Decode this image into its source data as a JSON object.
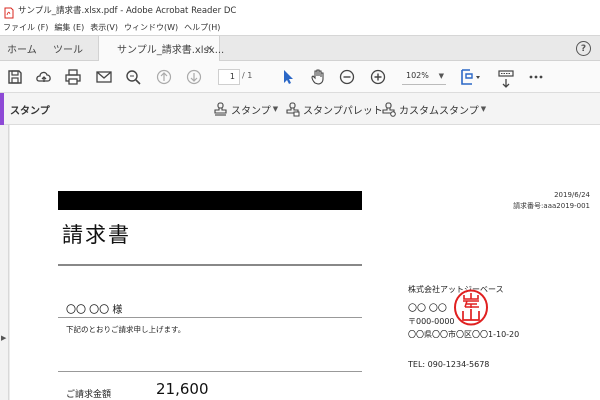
{
  "window": {
    "title": "サンプル_請求書.xlsx.pdf - Adobe Acrobat Reader DC"
  },
  "menu": [
    "ファイル (F)",
    "編集 (E)",
    "表示(V)",
    "ウィンドウ(W)",
    "ヘルプ(H)"
  ],
  "tabs": {
    "home": "ホーム",
    "tools": "ツール",
    "document": "サンプル_請求書.xlsx...",
    "close_glyph": "×",
    "help_glyph": "?"
  },
  "toolbar": {
    "icons": [
      "save-icon",
      "upload-icon",
      "print-icon",
      "email-icon",
      "zoom-search-icon",
      "page-up-icon",
      "page-down-icon",
      "select-arrow-icon",
      "hand-icon",
      "zoom-out-icon",
      "zoom-in-icon",
      "fit-page-icon",
      "keyboard-icon",
      "download-icon",
      "more-icon"
    ],
    "current_page": "1",
    "total_pages": "/ 1",
    "zoom": "102%"
  },
  "stamp_bar": {
    "label": "スタンプ",
    "buttons": {
      "stamp": "スタンプ",
      "palette": "スタンプパレット",
      "custom": "カスタムスタンプ"
    }
  },
  "document": {
    "title": "請求書",
    "date": "2019/6/24",
    "invoice_number": "請求番号:aaa2019-001",
    "customer": "〇〇  〇〇 様",
    "body_text": "下記のとおりご請求申し上げます。",
    "amount_label": "ご請求金額",
    "amount_value": "21,600",
    "company": "株式会社アットジーベース",
    "person": "〇〇  〇〇",
    "zip": "〒000-0000",
    "address": "〇〇県〇〇市〇区〇〇1-10-20",
    "tel": "TEL:  090-1234-5678",
    "seal_text": "岸山"
  },
  "colors": {
    "accent": "#8e4ad6",
    "seal": "#e02020",
    "pdf_icon": "#d9261c",
    "blue_icon": "#2b67c6"
  }
}
